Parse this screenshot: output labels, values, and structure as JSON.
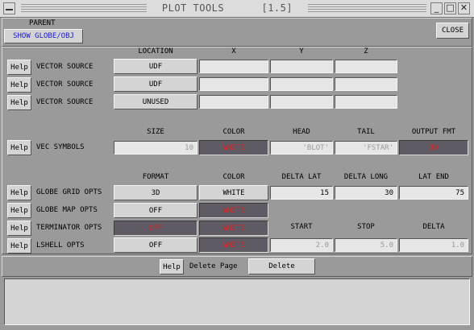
{
  "window": {
    "title": "PLOT TOOLS",
    "version": "[1.5]",
    "minimize_glyph": "_",
    "maximize_glyph": "□",
    "close_glyph": "✕"
  },
  "header": {
    "parent_label": "PARENT",
    "show_globe_button": "SHOW GLOBE/OBJ",
    "close_button": "CLOSE"
  },
  "help_label": "Help",
  "vector_sources": {
    "headers": {
      "location": "LOCATION",
      "x": "X",
      "y": "Y",
      "z": "Z"
    },
    "rows": [
      {
        "label": "VECTOR SOURCE",
        "location": "UDF",
        "x": "",
        "y": "",
        "z": ""
      },
      {
        "label": "VECTOR SOURCE",
        "location": "UDF",
        "x": "",
        "y": "",
        "z": ""
      },
      {
        "label": "VECTOR SOURCE",
        "location": "UNUSED",
        "x": "",
        "y": "",
        "z": ""
      }
    ]
  },
  "vec_symbols": {
    "headers": {
      "size": "SIZE",
      "color": "COLOR",
      "head": "HEAD",
      "tail": "TAIL",
      "output_fmt": "OUTPUT FMT"
    },
    "label": "VEC SYMBOLS",
    "size": "10",
    "color": "WHITE",
    "head": "'BLOT'",
    "tail": "'FSTAR'",
    "output_fmt": "3D"
  },
  "globe_opts": {
    "headers": {
      "format": "FORMAT",
      "color": "COLOR",
      "delta_lat": "DELTA LAT",
      "delta_long": "DELTA LONG",
      "lat_end": "LAT END"
    },
    "grid": {
      "label": "GLOBE GRID OPTS",
      "format": "3D",
      "color": "WHITE",
      "delta_lat": "15",
      "delta_long": "30",
      "lat_end": "75"
    },
    "map": {
      "label": "GLOBE MAP OPTS",
      "format": "OFF",
      "color": "WHITE"
    },
    "terminator": {
      "label": "TERMINATOR OPTS",
      "format": "OFF",
      "color": "WHITE"
    },
    "sub_headers": {
      "start": "START",
      "stop": "STOP",
      "delta": "DELTA"
    },
    "lshell": {
      "label": "LSHELL OPTS",
      "format": "OFF",
      "color": "WHITE",
      "start": "2.0",
      "stop": "5.0",
      "delta": "1.0"
    }
  },
  "footer": {
    "delete_page_label": "Delete Page",
    "delete_button": "Delete"
  },
  "colors": {
    "background": "#9a9a9a",
    "button": "#d4d4d4",
    "field": "#e6e6e6",
    "dark_button": "#5f5a63",
    "red_text": "#e02020",
    "blue_text": "#1a1ad0"
  }
}
